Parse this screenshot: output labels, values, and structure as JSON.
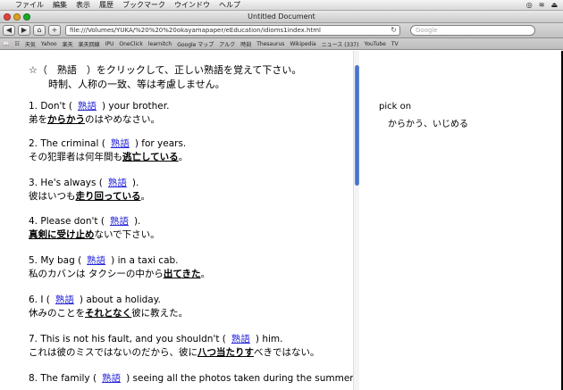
{
  "menubar": {
    "items": [
      "ファイル",
      "編集",
      "表示",
      "履歴",
      "ブックマーク",
      "ウインドウ",
      "ヘルプ"
    ]
  },
  "window": {
    "title": "Untitled Document"
  },
  "toolbar": {
    "back": "◀",
    "forward": "▶",
    "home": "⌂",
    "add": "+",
    "url": "file:///Volumes/YUKA/%20%20%20okayamapaper/eEducation/idioms1index.html",
    "search_placeholder": "Google"
  },
  "bookmarks": {
    "items": [
      "天気",
      "Yahoo",
      "楽天",
      "楽天回線",
      "IPU",
      "OneClick",
      "learnitch",
      "Google マップ",
      "アルク",
      "時刻",
      "Thesaurus",
      "Wikipedia",
      "ニュース (337)",
      "YouTube",
      "TV"
    ]
  },
  "instructions": {
    "line1": "☆（　熟語　）をクリックして、正しい熟語を覚えて下さい。",
    "line2": "時制、人称の一致、等は考慮しません。"
  },
  "link_text": "熟語",
  "questions": [
    {
      "pre": "1. Don't (",
      "post": ") your brother.",
      "ja_pre": "弟を",
      "ja_hl": "からかう",
      "ja_post": "のはやめなさい。"
    },
    {
      "pre": "2. The criminal (",
      "post": ") for years.",
      "ja_pre": "その犯罪者は何年間も",
      "ja_hl": "逃亡している",
      "ja_post": "。"
    },
    {
      "pre": "3. He's always (",
      "post": ").",
      "ja_pre": "彼はいつも",
      "ja_hl": "走り回っている",
      "ja_post": "。"
    },
    {
      "pre": "4. Please don't (",
      "post": ").",
      "ja_pre": "",
      "ja_hl": "真剣に受け止め",
      "ja_post": "ないで下さい。"
    },
    {
      "pre": "5. My bag (",
      "post": ") in a taxi cab.",
      "ja_pre": "私のカバンは タクシーの中から",
      "ja_hl": "出てきた",
      "ja_post": "。"
    },
    {
      "pre": "6. I (",
      "post": ") about a holiday.",
      "ja_pre": "休みのことを",
      "ja_hl": "それとなく",
      "ja_post": "彼に教えた。"
    },
    {
      "pre": "7. This is not his fault, and you shouldn't (",
      "post": ") him.",
      "ja_pre": "これは彼のミスではないのだから、彼に",
      "ja_hl": "八つ当たりす",
      "ja_post": "べきではない。"
    },
    {
      "pre": "8. The family (",
      "post": ") seeing all the photos taken during the summer",
      "ja_pre": "",
      "ja_hl": "",
      "ja_post": ""
    }
  ],
  "answer": {
    "phrase": "pick on",
    "meaning": "からかう、いじめる"
  }
}
